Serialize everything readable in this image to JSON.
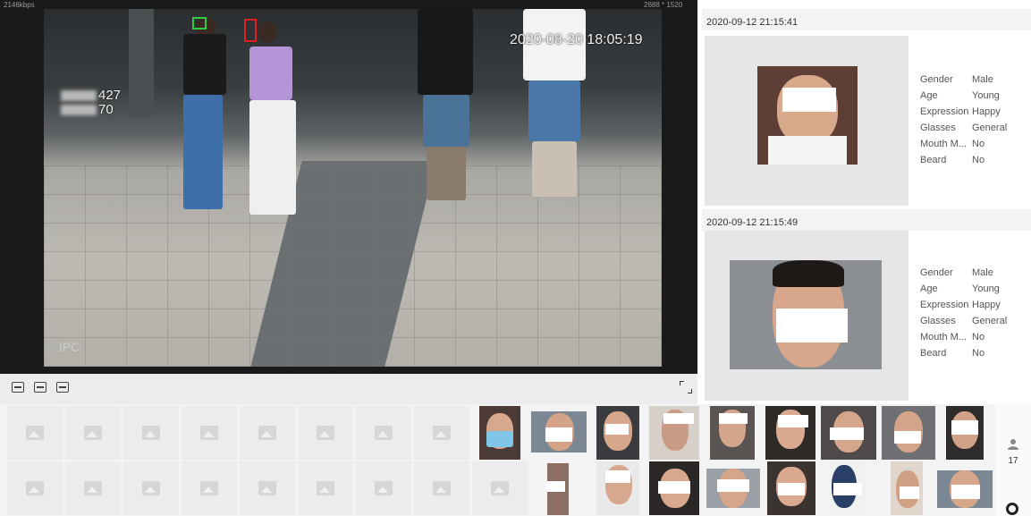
{
  "video": {
    "bitrate": "2146kbps",
    "resolution": "2688 * 1520",
    "timestamp": "2020-08-20 18:05:19",
    "counter_top": "427",
    "counter_bottom": "70",
    "channel_label": "IPC"
  },
  "toolbar": {
    "icons": [
      "original-scale-icon",
      "pip-mode-icon",
      "fit-window-icon",
      "fullscreen-icon"
    ]
  },
  "cards": [
    {
      "time": "2020-09-12 21:15:41",
      "attributes": [
        {
          "key": "Gender",
          "value": "Male"
        },
        {
          "key": "Age",
          "value": "Young"
        },
        {
          "key": "Expression",
          "value": "Happy"
        },
        {
          "key": "Glasses",
          "value": "General"
        },
        {
          "key": "Mouth M...",
          "value": "No"
        },
        {
          "key": "Beard",
          "value": "No"
        }
      ]
    },
    {
      "time": "2020-09-12 21:15:49",
      "attributes": [
        {
          "key": "Gender",
          "value": "Male"
        },
        {
          "key": "Age",
          "value": "Young"
        },
        {
          "key": "Expression",
          "value": "Happy"
        },
        {
          "key": "Glasses",
          "value": "General"
        },
        {
          "key": "Mouth M...",
          "value": "No"
        },
        {
          "key": "Beard",
          "value": "No"
        }
      ]
    }
  ],
  "stats": {
    "people_count": "17"
  },
  "colors": {
    "accent_green": "#2ecc40",
    "accent_red": "#e02020",
    "panel_header_bg": "#f1f3f5"
  }
}
